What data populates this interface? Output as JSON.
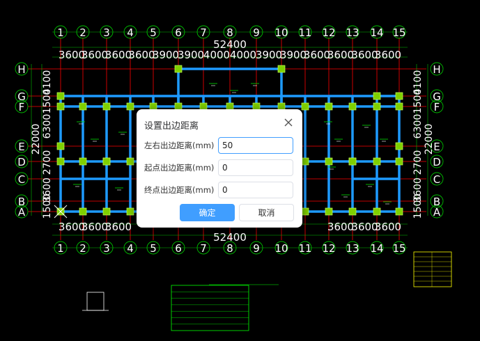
{
  "drawing": {
    "top_axes": [
      "1",
      "2",
      "3",
      "4",
      "5",
      "6",
      "7",
      "8",
      "9",
      "10",
      "11",
      "12",
      "13",
      "14",
      "15"
    ],
    "bottom_axes": [
      "1",
      "2",
      "3",
      "4",
      "5",
      "6",
      "7",
      "8",
      "9",
      "10",
      "11",
      "12",
      "13",
      "14",
      "15"
    ],
    "left_axes": [
      "H",
      "G",
      "F",
      "E",
      "D",
      "C",
      "B",
      "A"
    ],
    "right_axes": [
      "H",
      "G",
      "F",
      "E",
      "D",
      "C",
      "B",
      "A"
    ],
    "top_spacings": [
      "3600",
      "3600",
      "3600",
      "3600",
      "3900",
      "3900",
      "4000",
      "4000",
      "3900",
      "3900",
      "3600",
      "3600",
      "3600",
      "3600"
    ],
    "bottom_spacings_left": [
      "3600",
      "3600",
      "3600"
    ],
    "bottom_spacings_right": [
      "3600",
      "3600",
      "3600"
    ],
    "total_top": "52400",
    "total_bottom": "52400",
    "left_side_dims": [
      "4100",
      "1500",
      "6300",
      "2700",
      "3600",
      "1500"
    ],
    "left_total": "22000",
    "right_side_dims": [
      "4100",
      "1500",
      "6300",
      "2700",
      "3600",
      "1500"
    ],
    "right_total": "22000",
    "colors": {
      "background": "#000000",
      "axis_line": "#ff0000",
      "axis_bubble": "#00c000",
      "dim_text": "#ffffff",
      "beam": "#1e9bff",
      "column": "#7fd000",
      "rebar_text": "#00e000"
    }
  },
  "dialog": {
    "title": "设置出边距离",
    "close_icon": "close-icon",
    "fields": [
      {
        "label": "左右出边距离(mm)",
        "value": "50"
      },
      {
        "label": "起点出边距离(mm)",
        "value": "0"
      },
      {
        "label": "终点出边距离(mm)",
        "value": "0"
      }
    ],
    "ok_label": "确定",
    "cancel_label": "取消"
  }
}
